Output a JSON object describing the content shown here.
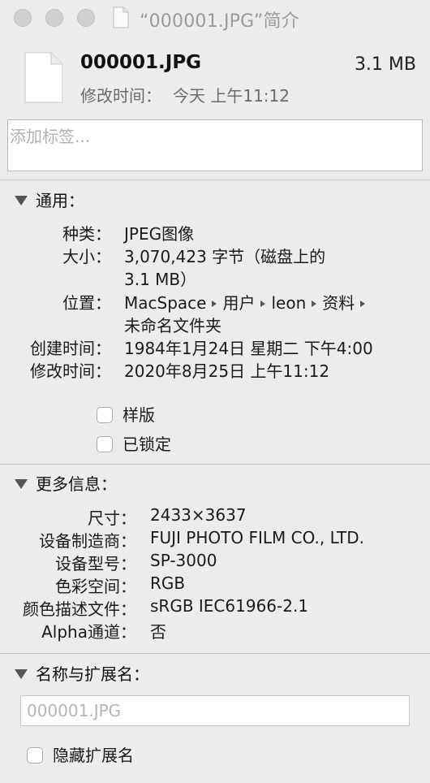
{
  "window": {
    "title": "“000001.JPG”简介",
    "buttons": [
      "close",
      "minimize",
      "zoom"
    ],
    "title_icon": "document-icon"
  },
  "header": {
    "file_icon": "document-icon",
    "file_name": "000001.JPG",
    "file_size": "3.1 MB",
    "modified_label": "修改时间：",
    "modified_value": "今天 上午11:12"
  },
  "tags": {
    "placeholder": "添加标签..."
  },
  "general": {
    "title": "通用：",
    "kind_label": "种类：",
    "kind_value": "JPEG图像",
    "size_label": "大小：",
    "size_value_line1": "3,070,423 字节（磁盘上的",
    "size_value_line2": "3.1 MB）",
    "where_label": "位置：",
    "where_path": [
      "MacSpace",
      "用户",
      "leon",
      "资料"
    ],
    "where_path_line2": "未命名文件夹",
    "created_label": "创建时间：",
    "created_value": "1984年1月24日 星期二 下午4:00",
    "modified_label": "修改时间：",
    "modified_value": "2020年8月25日 上午11:12",
    "stationery_label": "样版",
    "stationery_checked": false,
    "locked_label": "已锁定",
    "locked_checked": false
  },
  "more_info": {
    "title": "更多信息：",
    "rows": [
      {
        "label": "尺寸：",
        "value": "2433×3637"
      },
      {
        "label": "设备制造商：",
        "value": "FUJI PHOTO FILM CO., LTD."
      },
      {
        "label": "设备型号：",
        "value": "SP-3000"
      },
      {
        "label": "色彩空间：",
        "value": "RGB"
      },
      {
        "label": "颜色描述文件：",
        "value": "sRGB IEC61966-2.1"
      },
      {
        "label": "Alpha通道：",
        "value": "否"
      }
    ]
  },
  "name_ext": {
    "title": "名称与扩展名：",
    "name_value": "000001.JPG",
    "hide_ext_label": "隐藏扩展名",
    "hide_ext_checked": false
  }
}
